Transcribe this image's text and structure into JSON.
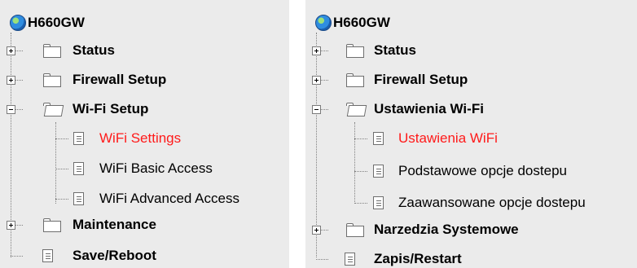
{
  "left": {
    "root": "H660GW",
    "status": "Status",
    "firewall": "Firewall Setup",
    "wifi_setup": "Wi-Fi Setup",
    "wifi_settings": "WiFi Settings",
    "wifi_basic": "WiFi Basic Access",
    "wifi_advanced": "WiFi Advanced Access",
    "maintenance": "Maintenance",
    "save_reboot": "Save/Reboot"
  },
  "right": {
    "root": "H660GW",
    "status": "Status",
    "firewall": "Firewall Setup",
    "wifi_setup": "Ustawienia Wi-Fi",
    "wifi_settings": "Ustawienia WiFi",
    "wifi_basic": "Podstawowe opcje dostepu",
    "wifi_advanced": "Zaawansowane opcje dostepu",
    "maintenance": "Narzedzia Systemowe",
    "save_reboot": "Zapis/Restart"
  },
  "colors": {
    "panel_bg": "#ebebeb",
    "active_text": "#ff1a1a"
  },
  "icons": [
    "globe-icon",
    "folder-icon",
    "folder-open-icon",
    "page-icon",
    "expand-icon",
    "collapse-icon"
  ]
}
